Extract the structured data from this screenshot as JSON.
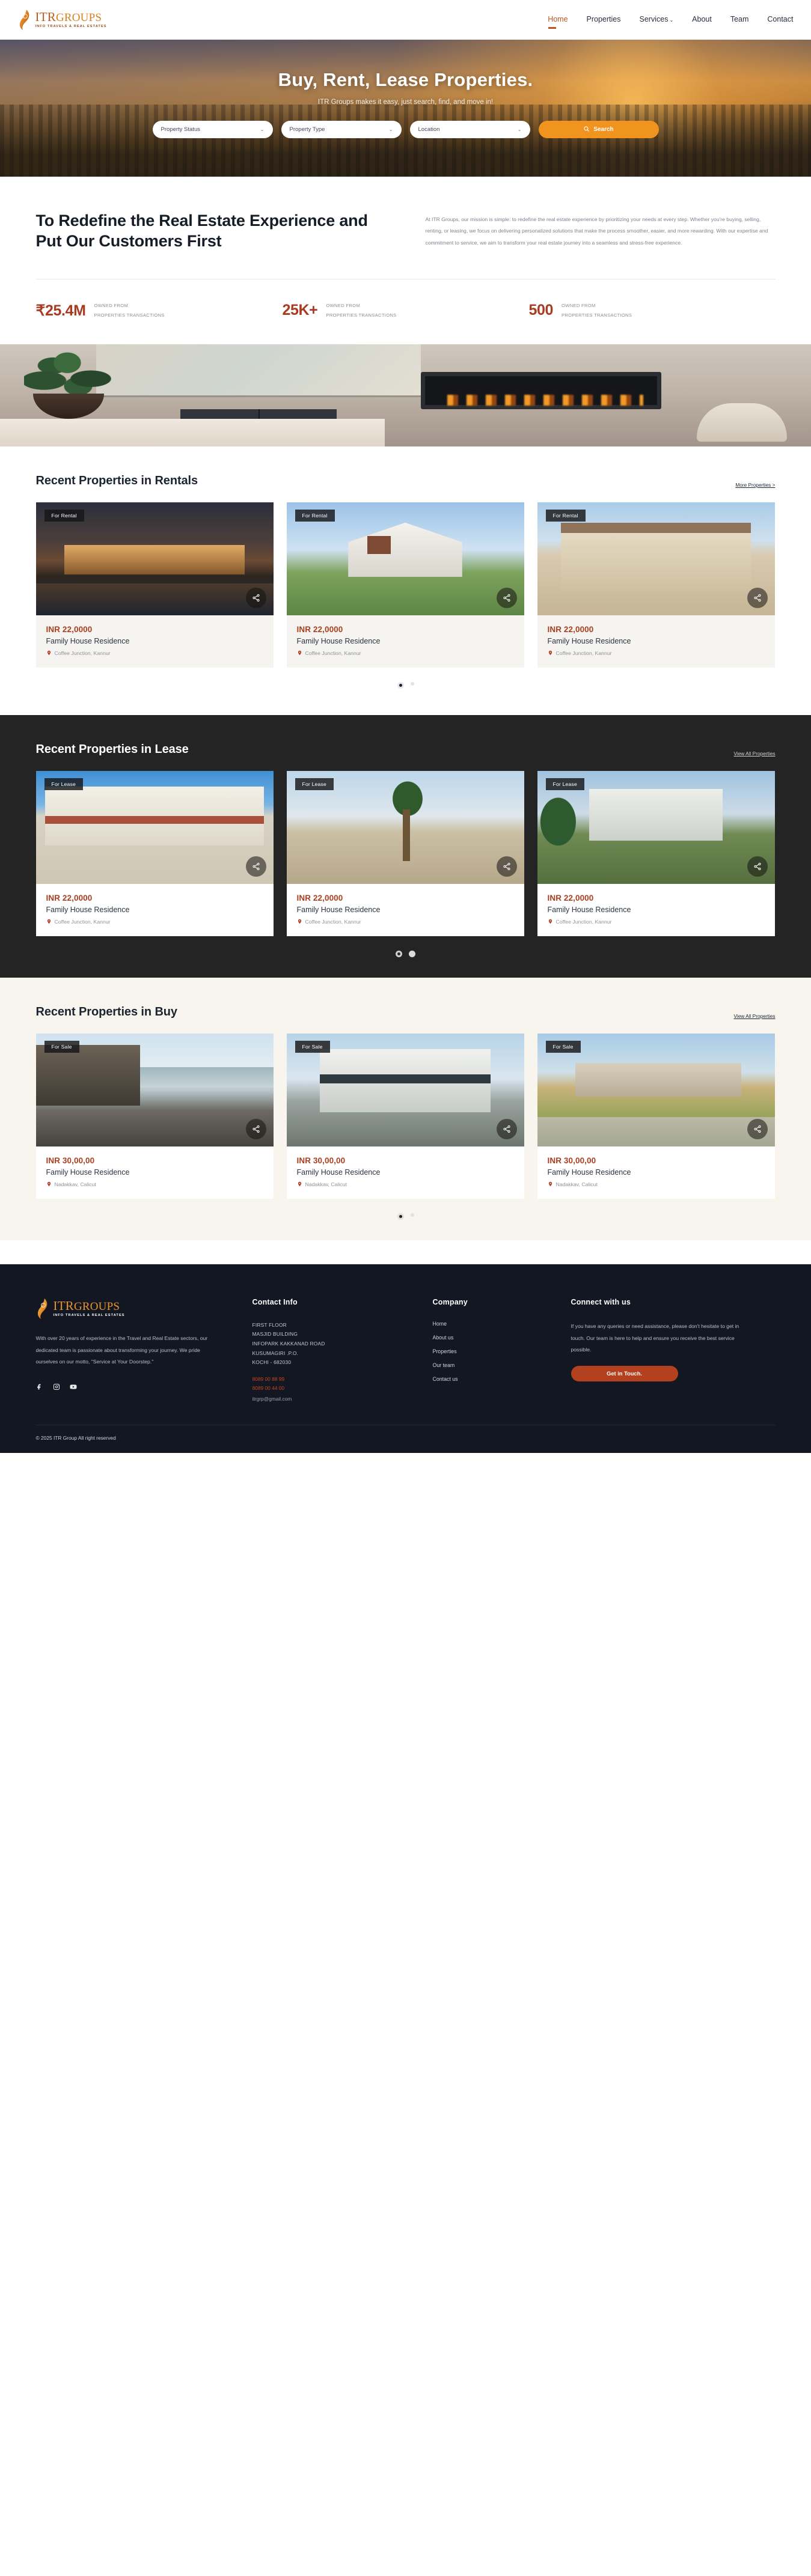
{
  "brand": {
    "name_part1": "ITR",
    "name_part2": "GROUPS",
    "tagline": "INFO TRAVELS & REAL ESTATES",
    "accent": "#c1521d",
    "logo_icon": "flame-ribbon-icon"
  },
  "nav": {
    "items": [
      {
        "label": "Home",
        "active": true
      },
      {
        "label": "Properties",
        "active": false
      },
      {
        "label": "Services",
        "active": false,
        "has_dropdown": true
      },
      {
        "label": "About",
        "active": false
      },
      {
        "label": "Team",
        "active": false
      },
      {
        "label": "Contact",
        "active": false
      }
    ]
  },
  "hero": {
    "title": "Buy, Rent, Lease Properties.",
    "subtitle": "ITR Groups makes it easy, just search, find, and move in!",
    "filters": [
      {
        "label": "Property Status"
      },
      {
        "label": "Property Type"
      },
      {
        "label": "Location"
      }
    ],
    "search_label": "Search"
  },
  "about": {
    "heading": "To Redefine the Real Estate Experience and Put Our Customers First",
    "paragraph": "At ITR Groups, our mission is simple: to redefine the real estate experience by prioritizing your needs at every step. Whether you're buying, selling, renting, or leasing, we focus on delivering personalized solutions that make the process smoother, easier, and more rewarding. With our expertise and commitment to service, we aim to transform your real estate journey into a seamless and stress-free experience.",
    "stats": [
      {
        "value": "₹25.4M",
        "line1": "OWNED FROM",
        "line2": "PROPERTIES TRANSACTIONS"
      },
      {
        "value": "25K+",
        "line1": "OWNED FROM",
        "line2": "PROPERTIES TRANSACTIONS"
      },
      {
        "value": "500",
        "line1": "OWNED FROM",
        "line2": "PROPERTIES TRANSACTIONS"
      }
    ]
  },
  "sections": [
    {
      "title": "Recent Properties in Rentals",
      "link": "More Properties >",
      "theme": "light",
      "cards": [
        {
          "tag": "For Rental",
          "price": "INR 22,0000",
          "name": "Family House Residence",
          "location": "Coffee Junction, Kannur",
          "img": "img-villa-night"
        },
        {
          "tag": "For Rental",
          "price": "INR 22,0000",
          "name": "Family House Residence",
          "location": "Coffee Junction, Kannur",
          "img": "img-house-snow"
        },
        {
          "tag": "For Rental",
          "price": "INR 22,0000",
          "name": "Family House Residence",
          "location": "Coffee Junction, Kannur",
          "img": "img-house-beige"
        }
      ],
      "dots": [
        {
          "active": true
        },
        {
          "active": false
        }
      ]
    },
    {
      "title": "Recent Properties in Lease",
      "link": "View All Properties",
      "theme": "dark",
      "cards": [
        {
          "tag": "For Lease",
          "price": "INR 22,0000",
          "name": "Family House Residence",
          "location": "Coffee Junction, Kannur",
          "img": "img-villa-spanish"
        },
        {
          "tag": "For Lease",
          "price": "INR 22,0000",
          "name": "Family House Residence",
          "location": "Coffee Junction, Kannur",
          "img": "img-palm"
        },
        {
          "tag": "For Lease",
          "price": "INR 22,0000",
          "name": "Family House Residence",
          "location": "Coffee Junction, Kannur",
          "img": "img-mansion"
        }
      ],
      "dots": [
        {
          "active": true
        },
        {
          "active": false
        }
      ]
    },
    {
      "title": "Recent Properties in Buy",
      "link": "View All Properties",
      "theme": "cream",
      "cards": [
        {
          "tag": "For Sale",
          "price": "INR 30,00,00",
          "name": "Family House Residence",
          "location": "Nadakkav, Calicut",
          "img": "img-sea-villa"
        },
        {
          "tag": "For Sale",
          "price": "INR 30,00,00",
          "name": "Family House Residence",
          "location": "Nadakkav, Calicut",
          "img": "img-modern-white"
        },
        {
          "tag": "For Sale",
          "price": "INR 30,00,00",
          "name": "Family House Residence",
          "location": "Nadakkav, Calicut",
          "img": "img-ranch"
        }
      ],
      "dots": [
        {
          "active": true
        },
        {
          "active": false
        }
      ]
    }
  ],
  "footer": {
    "about": "With over 20 years of experience in the Travel and Real Estate sectors, our dedicated team is passionate about transforming your journey. We pride ourselves on our motto, \"Service at Your Doorstep.\"",
    "contact": {
      "heading": "Contact Info",
      "address_lines": [
        "FIRST FLOOR",
        "MASJID BUILDING",
        "INFOPARK KAKKANAD ROAD",
        "KUSUMAGIRI .P.O.",
        "KOCHI - 682030"
      ],
      "phone1": "8089 00 88 99",
      "phone2": "8089 00 44 00",
      "email": "itrgrp@gmail.com"
    },
    "company": {
      "heading": "Company",
      "links": [
        {
          "label": "Home"
        },
        {
          "label": "About us"
        },
        {
          "label": "Properties"
        },
        {
          "label": "Our team"
        },
        {
          "label": "Contact us"
        }
      ]
    },
    "connect": {
      "heading": "Connect with us",
      "text": "If you have any queries or need assistance, please don't hesitate to get in touch. Our team is here to help and ensure you receive the best service possible.",
      "button": "Get in Touch."
    },
    "socials": [
      {
        "name": "facebook-icon"
      },
      {
        "name": "instagram-icon"
      },
      {
        "name": "youtube-icon"
      }
    ],
    "copyright": "© 2025 ITR Group All right reserved"
  }
}
